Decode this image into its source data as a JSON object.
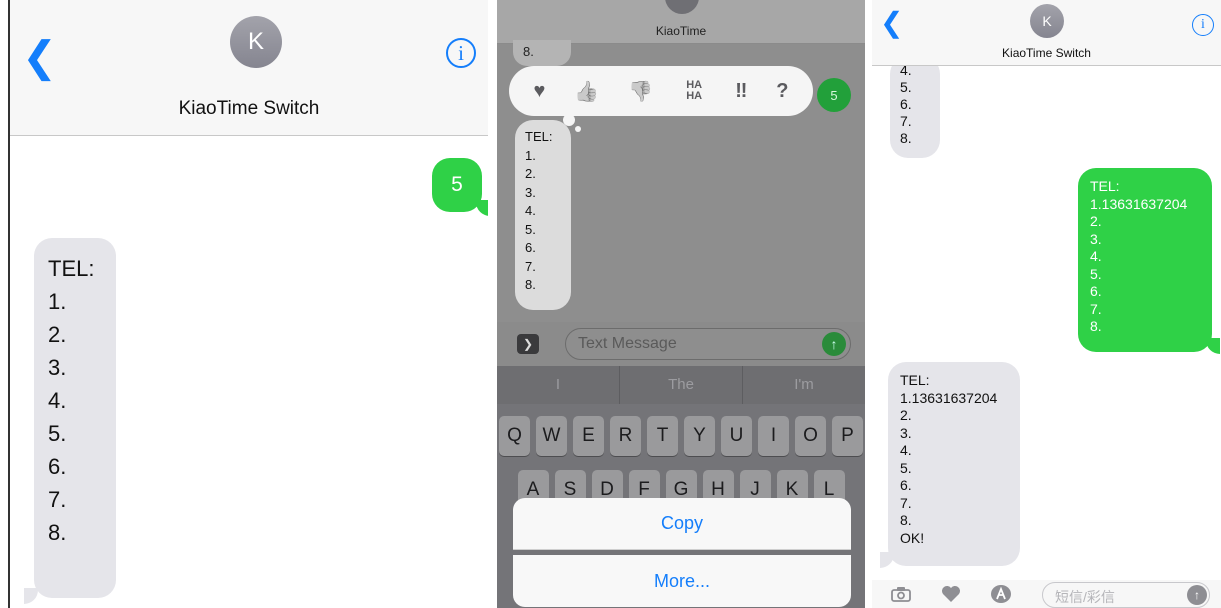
{
  "panel1": {
    "contact_initial": "K",
    "contact_name": "KiaoTime Switch",
    "outgoing": "5",
    "incoming": "TEL:\n1.\n2.\n3.\n4.\n5.\n6.\n7.\n8."
  },
  "panel2": {
    "contact_initial": "",
    "contact_name": "KiaoTime",
    "peek_text": "8.",
    "tapbacks": [
      "♥",
      "👍",
      "👎",
      "HA HA",
      "‼",
      "?"
    ],
    "outgoing": "5",
    "incoming": "TEL:\n1.\n2.\n3.\n4.\n5.\n6.\n7.\n8.",
    "input_placeholder": "Text Message",
    "predictions": [
      "I",
      "The",
      "I'm"
    ],
    "keyboard_row1": [
      "Q",
      "W",
      "E",
      "R",
      "T",
      "Y",
      "U",
      "I",
      "O",
      "P"
    ],
    "keyboard_row2": [
      "A",
      "S",
      "D",
      "F",
      "G",
      "H",
      "J",
      "K",
      "L"
    ],
    "copy_label": "Copy",
    "more_label": "More..."
  },
  "panel3": {
    "contact_initial": "K",
    "contact_name": "KiaoTime Switch",
    "incoming_top": "4.\n5.\n6.\n7.\n8.",
    "outgoing": "TEL:\n1.13631637204\n2.\n3.\n4.\n5.\n6.\n7.\n8.",
    "incoming": "TEL:\n1.13631637204\n2.\n3.\n4.\n5.\n6.\n7.\n8.\nOK!",
    "input_placeholder": "短信/彩信"
  },
  "colors": {
    "accent": "#147efb",
    "sent": "#2fd147",
    "received": "#e5e5ea"
  }
}
